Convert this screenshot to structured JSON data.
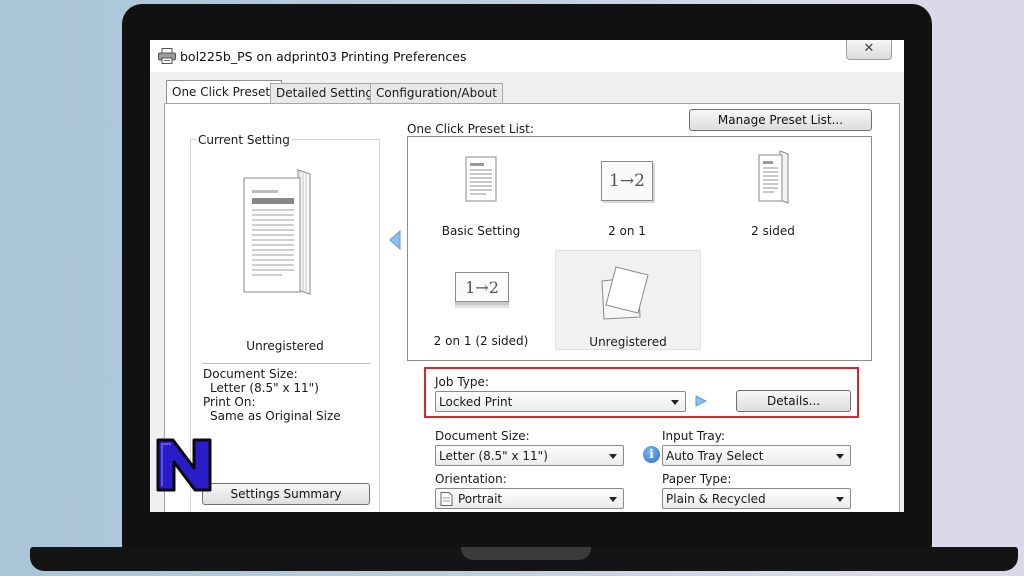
{
  "window": {
    "title": "bol225b_PS on adprint03 Printing Preferences",
    "close_label": "✕"
  },
  "tabs": [
    {
      "label": "One Click Presets",
      "active": true
    },
    {
      "label": "Detailed Settings",
      "active": false
    },
    {
      "label": "Configuration/About",
      "active": false
    }
  ],
  "current_setting": {
    "group_label": "Current Setting",
    "preset_name": "Unregistered",
    "document_size_label": "Document Size:",
    "document_size_value": "Letter (8.5\" x 11\")",
    "print_on_label": "Print On:",
    "print_on_value": "Same as Original Size",
    "summary_button": "Settings Summary"
  },
  "presets": {
    "list_label": "One Click Preset List:",
    "manage_button": "Manage Preset List...",
    "items": [
      {
        "label": "Basic Setting",
        "icon": "single-page-icon"
      },
      {
        "label": "2 on 1",
        "icon": "n-up-icon",
        "icon_text": "1→2"
      },
      {
        "label": "2 sided",
        "icon": "duplex-icon"
      },
      {
        "label": "2 on 1 (2 sided)",
        "icon": "n-up-duplex-icon",
        "icon_text": "1→2"
      },
      {
        "label": "Unregistered",
        "icon": "blank-pages-icon",
        "selected": true
      }
    ]
  },
  "job_type": {
    "label": "Job Type:",
    "value": "Locked Print",
    "details_button": "Details..."
  },
  "document_size": {
    "label": "Document Size:",
    "value": "Letter (8.5\" x 11\")"
  },
  "input_tray": {
    "label": "Input Tray:",
    "value": "Auto Tray Select"
  },
  "orientation": {
    "label": "Orientation:",
    "value": "Portrait"
  },
  "paper_type": {
    "label": "Paper Type:",
    "value": "Plain & Recycled"
  },
  "colors": {
    "highlight_border": "#d6272f",
    "logo_fill": "#2a1cc9",
    "accent_blue": "#3d8ad8"
  }
}
